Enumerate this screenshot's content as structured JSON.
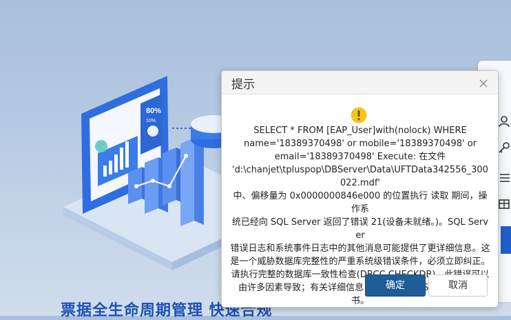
{
  "background": {
    "headline": "票据全生命周期管理 快速合规",
    "card_percent": "80%",
    "card_sub_percent": "10%"
  },
  "dialog": {
    "title": "提示",
    "close_icon": "close-icon",
    "warning_icon": "warning-icon",
    "message_lines": [
      "SELECT * FROM [EAP_User]with(nolock) WHERE",
      "name='18389370498' or mobile='18389370498' or",
      "email='18389370498' Execute: 在文件",
      "'d:\\chanjet\\tpluspop\\DBServer\\Data\\UFTData342556_300022.mdf'",
      "中、偏移量为 0x0000000846e000 的位置执行 读取 期间，操作系",
      "统已经向 SQL Server 返回了错误 21(设备未就绪。)。SQL Server",
      "错误日志和系统事件日志中的其他消息可能提供了更详细信息。这",
      "是一个威胁数据库完整性的严重系统级错误条件，必须立即纠正。",
      "请执行完整的数据库一致性检查(DBCC CHECKDB)。此错误可以",
      "由许多因素导致；有关详细信息，请参阅 SQL Server 联机丛书。"
    ],
    "ok_label": "确定",
    "cancel_label": "取消"
  },
  "colors": {
    "primary": "#1f5d99",
    "warning": "#f5c518",
    "headline": "#1e50b4"
  }
}
